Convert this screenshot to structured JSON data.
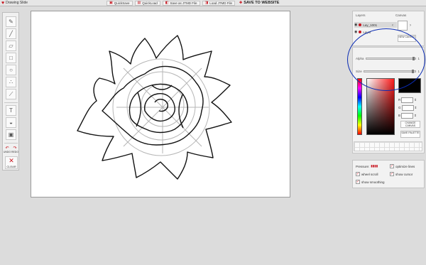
{
  "app": {
    "title": "Drawing Slide"
  },
  "toolbar": {
    "quicksave": "QuickSave",
    "quickload": "QuickLoad",
    "save_as": "Save as JTMD File",
    "load": "Load JTMD File",
    "save_web": "SAVE TO WEBSITE"
  },
  "tools": {
    "items": [
      "pencil",
      "brush",
      "eraser",
      "rectangle",
      "ellipse",
      "spray",
      "eyedropper",
      "text",
      "fill",
      "select"
    ],
    "undo": "UNDO",
    "redo": "REDO",
    "clear": "CLEAR"
  },
  "layers": {
    "header_left": "Layers",
    "header_right": "Canvas",
    "items": [
      {
        "label": "Lay_1001"
      },
      {
        "label": "Layer"
      }
    ],
    "new_canvas": "NEW CANVAS"
  },
  "color": {
    "alpha_label": "Alpha",
    "alpha_value": "1",
    "alpha_level": 0.98,
    "size_label": "Size",
    "size_value": "1",
    "size_level": 0.96,
    "r_label": "R",
    "g_label": "G",
    "b_label": "B",
    "swatch_hex": "#000000",
    "hue_hex": "#ff1a1a",
    "change_canvas": "CHANGE CANVAS",
    "save_palette": "SAVE PALETTE"
  },
  "options": {
    "pressure_label": "Pressure:",
    "flames": "▮▮▮▮",
    "opt1": "optimize lines",
    "opt2": "wheel scroll",
    "opt3": "show cursor",
    "opt4": "show smoothing"
  }
}
